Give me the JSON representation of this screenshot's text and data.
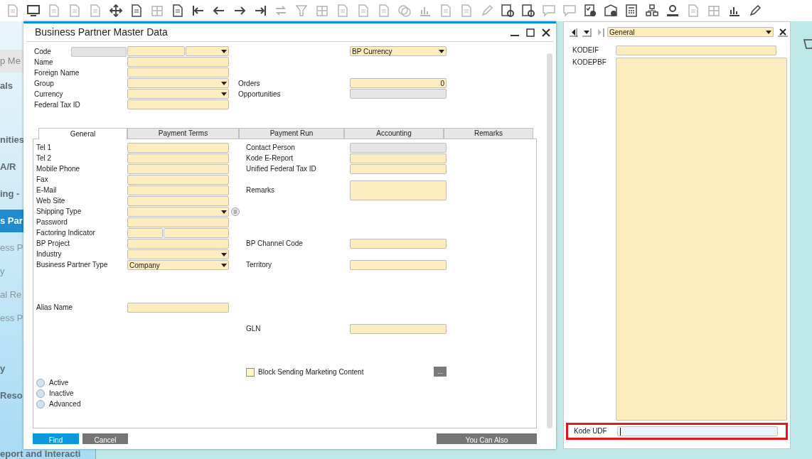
{
  "sidebar": {
    "items": [
      {
        "label": "p Me",
        "kind": "header",
        "selected": false
      },
      {
        "label": "als",
        "kind": "module",
        "selected": false
      },
      {
        "label": "nities",
        "kind": "module",
        "selected": false
      },
      {
        "label": "A/R",
        "kind": "module",
        "selected": false
      },
      {
        "label": "ing -",
        "kind": "module",
        "selected": false
      },
      {
        "label": "s Par",
        "kind": "module",
        "selected": true
      },
      {
        "label": "ess P",
        "kind": "item",
        "selected": false
      },
      {
        "label": "y",
        "kind": "item",
        "selected": false
      },
      {
        "label": "al Re",
        "kind": "item",
        "selected": false
      },
      {
        "label": "ess P",
        "kind": "item",
        "selected": false
      },
      {
        "label": "y",
        "kind": "module",
        "selected": false
      },
      {
        "label": "Reso",
        "kind": "module",
        "selected": false
      },
      {
        "label": "eport and Interacti",
        "kind": "module",
        "selected": false
      }
    ]
  },
  "window": {
    "title": "Business Partner Master Data",
    "header_left": [
      {
        "label": "Code",
        "kind": "code"
      },
      {
        "label": "Name",
        "kind": "text"
      },
      {
        "label": "Foreign Name",
        "kind": "text"
      },
      {
        "label": "Group",
        "kind": "dropdown"
      },
      {
        "label": "Currency",
        "kind": "dropdown"
      },
      {
        "label": "Federal Tax ID",
        "kind": "text"
      }
    ],
    "header_right": [
      {
        "kind": "dropdown",
        "value": "BP Currency"
      },
      {
        "label": "Orders",
        "kind": "text",
        "value": "0"
      },
      {
        "label": "Opportunities",
        "kind": "readonly"
      }
    ],
    "tabs": [
      {
        "label": "General",
        "selected": true
      },
      {
        "label": "Payment Terms",
        "selected": false
      },
      {
        "label": "Payment Run",
        "selected": false
      },
      {
        "label": "Accounting",
        "selected": false
      },
      {
        "label": "Remarks",
        "selected": false
      }
    ],
    "general_left": [
      {
        "label": "Tel 1",
        "kind": "text"
      },
      {
        "label": "Tel 2",
        "kind": "text"
      },
      {
        "label": "Mobile Phone",
        "kind": "text"
      },
      {
        "label": "Fax",
        "kind": "text"
      },
      {
        "label": "E-Mail",
        "kind": "text"
      },
      {
        "label": "Web Site",
        "kind": "text"
      },
      {
        "label": "Shipping Type",
        "kind": "lookup"
      },
      {
        "label": "Password",
        "kind": "text"
      },
      {
        "label": "Factoring Indicator",
        "kind": "split"
      },
      {
        "label": "BP Project",
        "kind": "text"
      },
      {
        "label": "Industry",
        "kind": "dropdown"
      },
      {
        "label": "Business Partner Type",
        "kind": "dropdown",
        "value": "Company"
      },
      {
        "label": "Alias Name",
        "kind": "text"
      }
    ],
    "general_right": [
      {
        "label": "Contact Person",
        "kind": "readonly"
      },
      {
        "label": "Kode E-Report",
        "kind": "text"
      },
      {
        "label": "Unified Federal Tax ID",
        "kind": "text"
      },
      {
        "label": "Remarks",
        "kind": "textarea"
      },
      {
        "label": "BP Channel Code",
        "kind": "text"
      },
      {
        "label": "Territory",
        "kind": "text"
      },
      {
        "label": "GLN",
        "kind": "text"
      }
    ],
    "marketing_checkbox": {
      "label": "Block Sending Marketing Content",
      "checked": false,
      "button": "..."
    },
    "status_options": [
      {
        "label": "Active",
        "selected": false
      },
      {
        "label": "Inactive",
        "selected": false
      },
      {
        "label": "Advanced",
        "selected": false
      }
    ],
    "buttons": [
      {
        "label": "Find",
        "kind": "primary"
      },
      {
        "label": "Cancel",
        "kind": "secondary"
      },
      {
        "label": "You Can Also",
        "kind": "menu"
      }
    ]
  },
  "udf_panel": {
    "category": "General",
    "fields": [
      {
        "label": "KODEIF",
        "kind": "text",
        "focused": false,
        "highlighted": false
      },
      {
        "label": "KODEPBF",
        "kind": "textarea",
        "focused": false,
        "highlighted": false
      },
      {
        "label": "Kode UDF",
        "kind": "text",
        "focused": true,
        "highlighted": true
      }
    ]
  }
}
